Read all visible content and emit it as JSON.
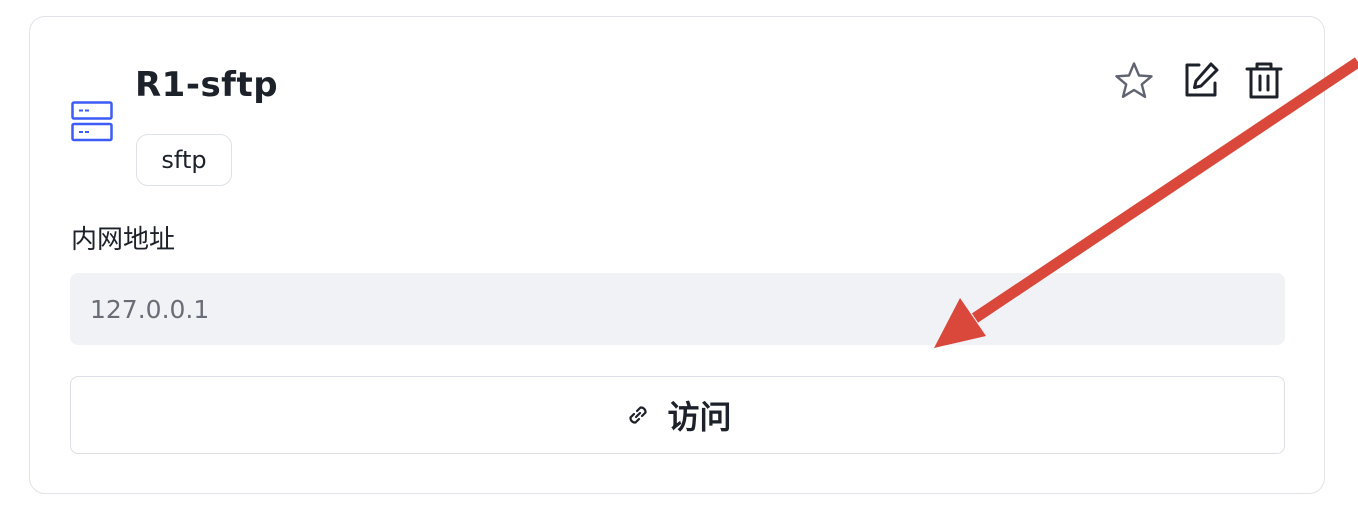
{
  "card": {
    "title": "R1-sftp",
    "tag": "sftp",
    "address_label": "内网地址",
    "address_value": "127.0.0.1",
    "visit_label": "访问"
  },
  "icons": {
    "server": "server-icon",
    "favorite": "star-icon",
    "edit": "edit-icon",
    "delete": "trash-icon",
    "link": "link-icon"
  },
  "colors": {
    "accent": "#3d5bf5",
    "annotation_arrow": "#d9483b"
  }
}
